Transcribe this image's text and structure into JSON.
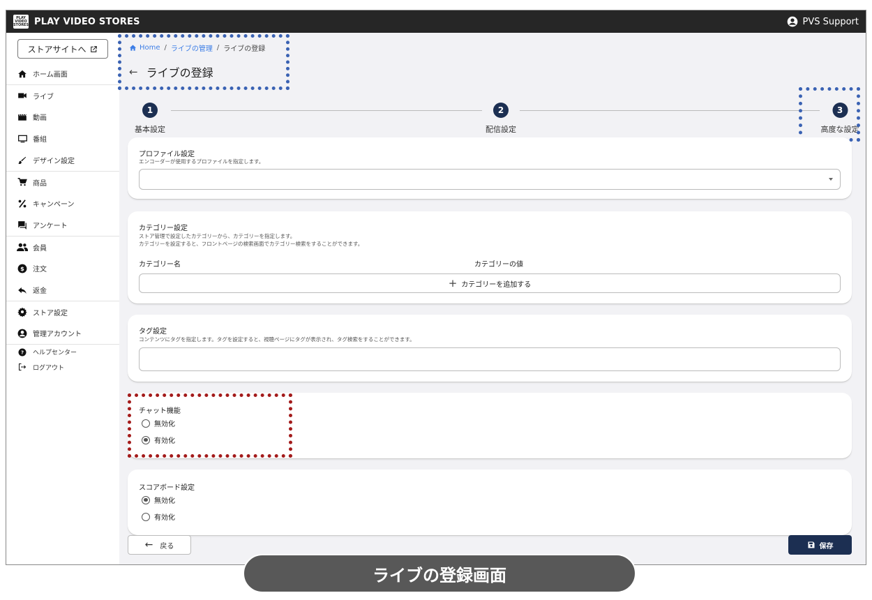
{
  "app": {
    "title": "PLAY VIDEO STORES",
    "logo_text": "PLAY VIDEO STORES"
  },
  "user": {
    "name": "PVS Support"
  },
  "sidebar": {
    "store_button": "ストアサイトへ",
    "items": [
      {
        "label": "ホーム画面",
        "icon": "home-icon"
      },
      {
        "label": "ライブ",
        "icon": "videocam-icon"
      },
      {
        "label": "動画",
        "icon": "movie-icon"
      },
      {
        "label": "番組",
        "icon": "monitor-icon"
      },
      {
        "label": "デザイン設定",
        "icon": "brush-icon"
      },
      {
        "label": "商品",
        "icon": "cart-icon"
      },
      {
        "label": "キャンペーン",
        "icon": "percent-icon"
      },
      {
        "label": "アンケート",
        "icon": "chat-icon"
      },
      {
        "label": "会員",
        "icon": "people-icon"
      },
      {
        "label": "注文",
        "icon": "dollar-icon"
      },
      {
        "label": "返金",
        "icon": "reply-icon"
      },
      {
        "label": "ストア設定",
        "icon": "gear-icon"
      },
      {
        "label": "管理アカウント",
        "icon": "account-icon"
      },
      {
        "label": "ヘルプセンター",
        "icon": "help-icon"
      },
      {
        "label": "ログアウト",
        "icon": "logout-icon"
      }
    ]
  },
  "breadcrumb": {
    "home": "Home",
    "sep": "/",
    "manage": "ライブの管理",
    "current": "ライブの登録"
  },
  "page": {
    "back_arrow": "←",
    "title": "ライブの登録"
  },
  "stepper": {
    "steps": [
      {
        "num": "1",
        "label": "基本設定"
      },
      {
        "num": "2",
        "label": "配信設定"
      },
      {
        "num": "3",
        "label": "高度な設定"
      }
    ]
  },
  "profile": {
    "title": "プロファイル設定",
    "desc": "エンコーダーが使用するプロファイルを指定します。",
    "value": ""
  },
  "category": {
    "title": "カテゴリー設定",
    "desc1": "ストア管理で設定したカテゴリーから、カテゴリーを指定します。",
    "desc2": "カテゴリーを設定すると、フロントページの検索画面でカテゴリー検索をすることができます。",
    "col_name": "カテゴリー名",
    "col_value": "カテゴリーの値",
    "add_plus": "+",
    "add_label": "カテゴリーを追加する"
  },
  "tags": {
    "title": "タグ設定",
    "desc": "コンテンツにタグを指定します。タグを設定すると、視聴ページにタグが表示され、タグ検索をすることができます。",
    "value": ""
  },
  "chat": {
    "title": "チャット機能",
    "option_off": "無効化",
    "option_on": "有効化",
    "selected": "有効化"
  },
  "scoreboard": {
    "title": "スコアボード設定",
    "option_off": "無効化",
    "option_on": "有効化",
    "selected": "無効化"
  },
  "footer": {
    "back_arrow": "←",
    "back_label": "戻る",
    "save_label": "保存"
  },
  "caption": "ライブの登録画面",
  "colors": {
    "topbar": "#262626",
    "accent": "#1c2f52",
    "link": "#3d7ee6",
    "highlight_blue": "#3a62b3",
    "highlight_red": "#a31b1b"
  }
}
